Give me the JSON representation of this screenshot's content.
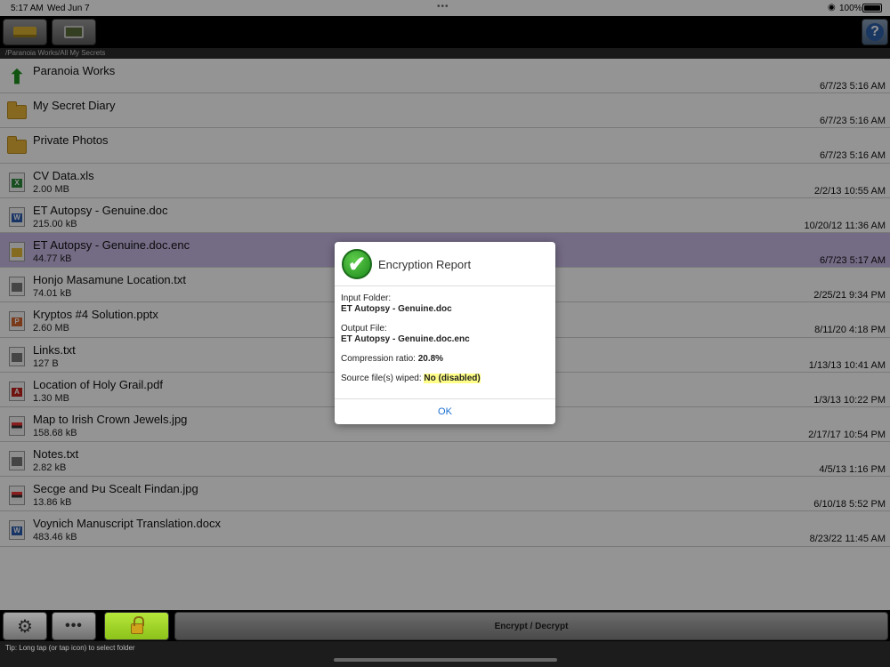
{
  "status": {
    "time": "5:17 AM",
    "date": "Wed Jun 7",
    "battery": "100%"
  },
  "path": "/Paranoia Works/All My Secrets",
  "files": [
    {
      "name": "Paranoia Works",
      "size": "",
      "date": "6/7/23 5:16 AM",
      "icon": "up-arrow-icon",
      "type": "up"
    },
    {
      "name": "My Secret Diary",
      "size": "",
      "date": "6/7/23 5:16 AM",
      "icon": "folder-icon",
      "type": "folder"
    },
    {
      "name": "Private Photos",
      "size": "",
      "date": "6/7/23 5:16 AM",
      "icon": "folder-icon",
      "type": "folder"
    },
    {
      "name": "CV Data.xls",
      "size": "2.00 MB",
      "date": "2/2/13 10:55 AM",
      "icon": "excel-file-icon",
      "type": "xls"
    },
    {
      "name": "ET Autopsy - Genuine.doc",
      "size": "215.00 kB",
      "date": "10/20/12 11:36 AM",
      "icon": "word-file-icon",
      "type": "word"
    },
    {
      "name": "ET Autopsy - Genuine.doc.enc",
      "size": "44.77 kB",
      "date": "6/7/23 5:17 AM",
      "icon": "encrypted-file-icon",
      "type": "enc",
      "selected": true
    },
    {
      "name": "Honjo Masamune Location.txt",
      "size": "74.01 kB",
      "date": "2/25/21 9:34 PM",
      "icon": "text-file-icon",
      "type": "txt"
    },
    {
      "name": "Kryptos #4 Solution.pptx",
      "size": "2.60 MB",
      "date": "8/11/20 4:18 PM",
      "icon": "powerpoint-file-icon",
      "type": "ppt"
    },
    {
      "name": "Links.txt",
      "size": "127 B",
      "date": "1/13/13 10:41 AM",
      "icon": "text-file-icon",
      "type": "txt"
    },
    {
      "name": "Location of Holy Grail.pdf",
      "size": "1.30 MB",
      "date": "1/3/13 10:22 PM",
      "icon": "pdf-file-icon",
      "type": "pdf"
    },
    {
      "name": "Map to Irish Crown Jewels.jpg",
      "size": "158.68 kB",
      "date": "2/17/17 10:54 PM",
      "icon": "image-file-icon",
      "type": "jpg"
    },
    {
      "name": "Notes.txt",
      "size": "2.82 kB",
      "date": "4/5/13 1:16 PM",
      "icon": "text-file-icon",
      "type": "txt"
    },
    {
      "name": "Secge and Þu Scealt Findan.jpg",
      "size": "13.86 kB",
      "date": "6/10/18 5:52 PM",
      "icon": "image-file-icon",
      "type": "jpg"
    },
    {
      "name": "Voynich Manuscript Translation.docx",
      "size": "483.46 kB",
      "date": "8/23/22 11:45 AM",
      "icon": "word-file-icon",
      "type": "word"
    }
  ],
  "dialog": {
    "title": "Encryption Report",
    "input_label": "Input Folder:",
    "input_value": "ET Autopsy - Genuine.doc",
    "output_label": "Output File:",
    "output_value": "ET Autopsy - Genuine.doc.enc",
    "compression_label": "Compression ratio:",
    "compression_value": "20.8%",
    "wiped_label": "Source file(s) wiped:",
    "wiped_value": "No (disabled)",
    "ok_label": "OK"
  },
  "bottom_toolbar": {
    "encrypt_label": "Encrypt / Decrypt",
    "more_label": "•••"
  },
  "help_label": "?",
  "tip": "Tip: Long tap (or tap icon) to select folder"
}
